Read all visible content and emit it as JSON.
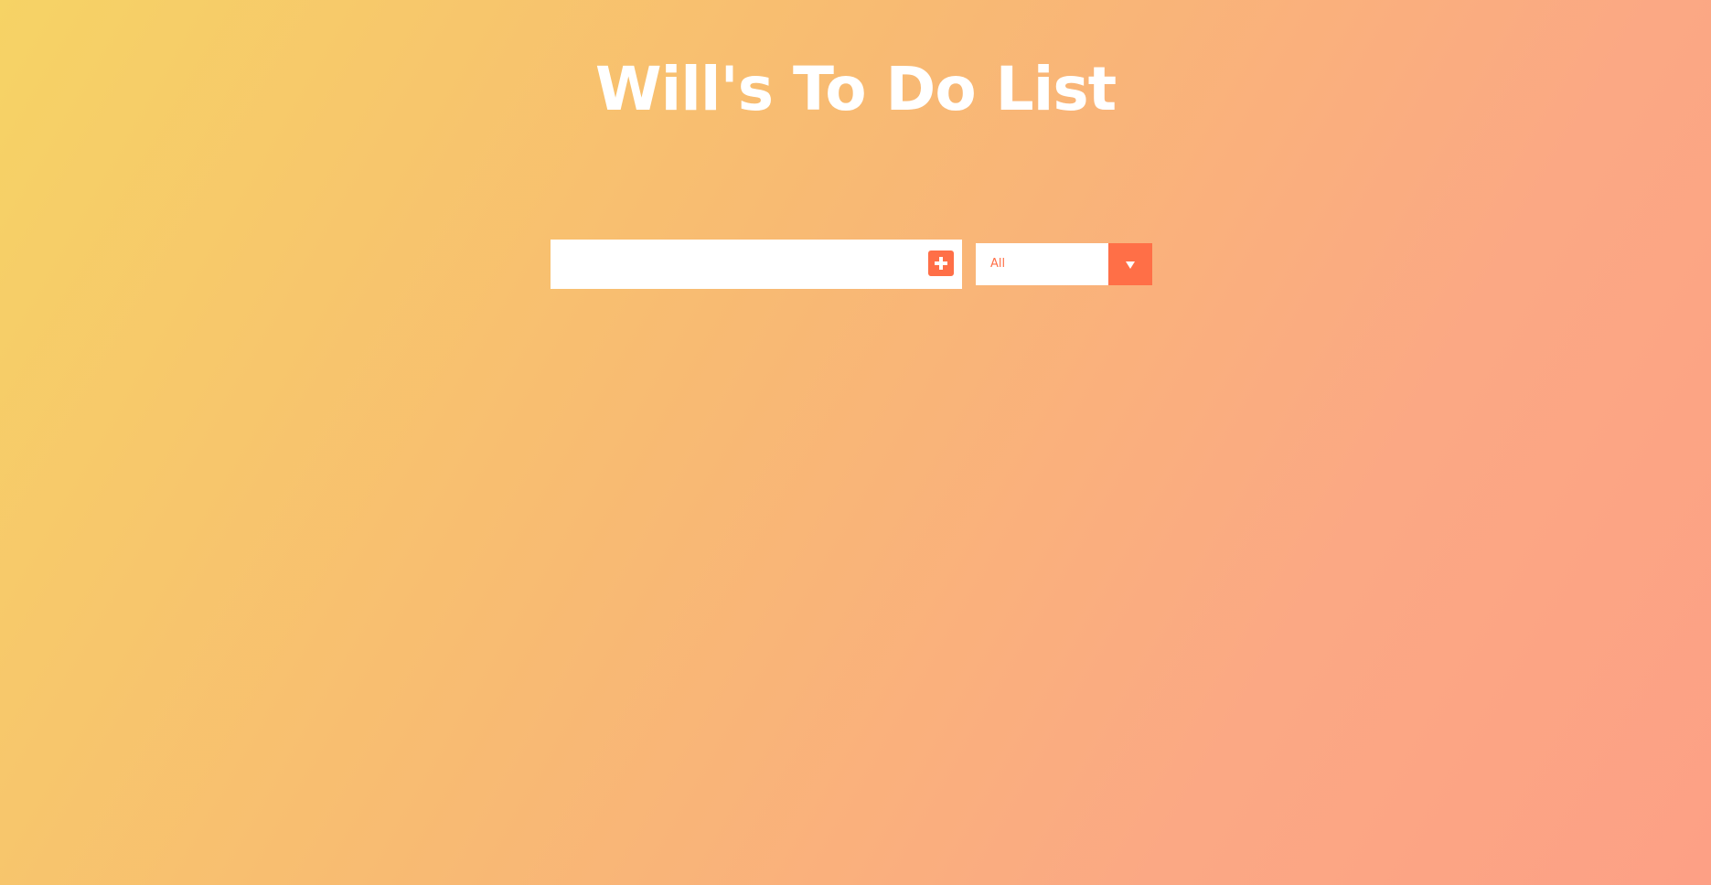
{
  "header": {
    "title": "Will's To Do List"
  },
  "todo_input": {
    "value": "",
    "placeholder": ""
  },
  "add_button": {
    "icon": "plus-square-icon"
  },
  "filter": {
    "selected": "All",
    "icon": "caret-down-icon"
  },
  "colors": {
    "background_start": "#f6d365",
    "background_end": "#fda085",
    "accent": "#ff6f47",
    "title_text": "#ffffff",
    "field_background": "#ffffff"
  }
}
